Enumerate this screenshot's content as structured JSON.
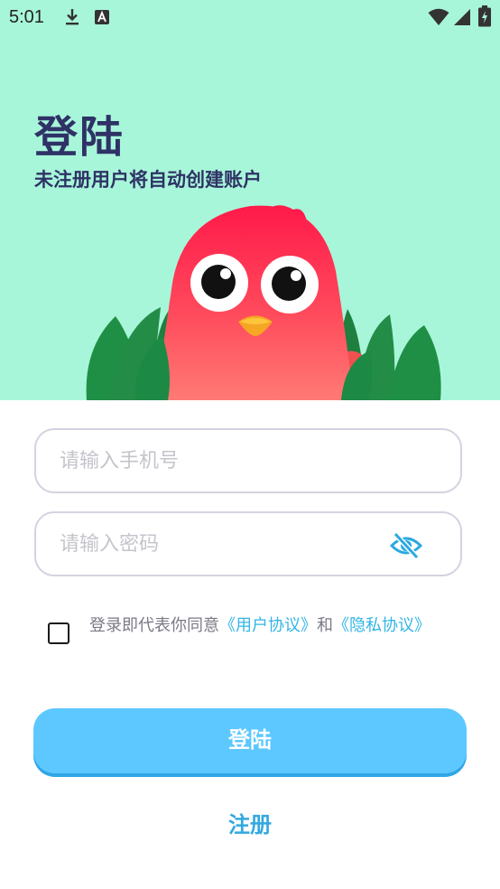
{
  "status_bar": {
    "time": "5:01",
    "icons": [
      "download-icon",
      "a-notification-icon",
      "wifi-icon",
      "signal-icon",
      "battery-charging-icon"
    ]
  },
  "header": {
    "title": "登陆",
    "subtitle": "未注册用户将自动创建账户"
  },
  "form": {
    "phone_placeholder": "请输入手机号",
    "password_placeholder": "请输入密码",
    "password_visibility_icon": "eye-off-icon"
  },
  "agreement": {
    "checked": false,
    "prefix": "登录即代表你同意",
    "user_agreement": "《用户协议》",
    "conjunction": "和",
    "privacy_policy": "《隐私协议》"
  },
  "actions": {
    "login_label": "登陆",
    "register_label": "注册"
  },
  "colors": {
    "hero_background": "#a8f6d9",
    "accent": "#5cc8ff",
    "link": "#33b5e5",
    "title": "#2f3266"
  }
}
